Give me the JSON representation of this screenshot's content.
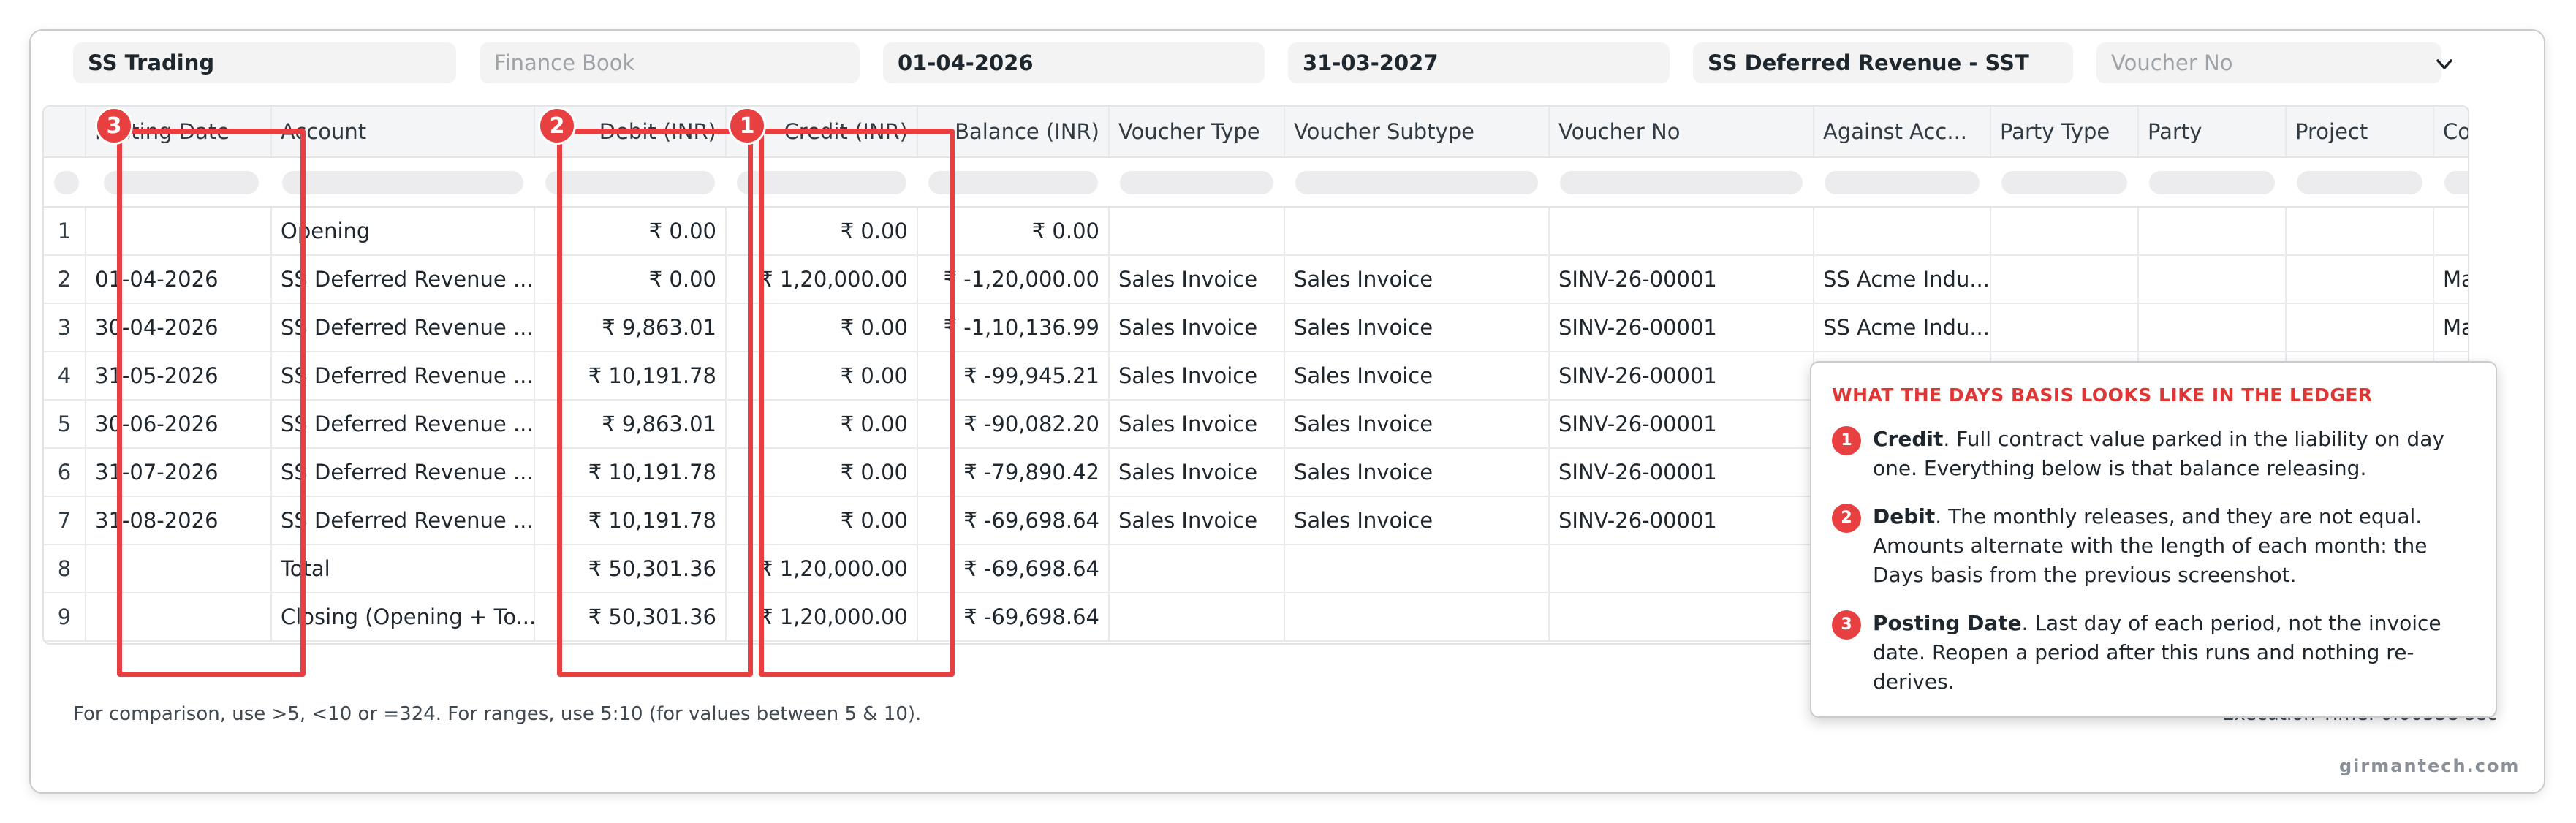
{
  "filters": {
    "company": "SS Trading",
    "finance_book_placeholder": "Finance Book",
    "from_date": "01-04-2026",
    "to_date": "31-03-2027",
    "account": "SS Deferred Revenue - SST",
    "voucher_no_placeholder": "Voucher No"
  },
  "table": {
    "columns": [
      "Posting Date",
      "Account",
      "Debit (INR)",
      "Credit (INR)",
      "Balance (INR)",
      "Voucher Type",
      "Voucher Subtype",
      "Voucher No",
      "Against Acc...",
      "Party Type",
      "Party",
      "Project",
      "Co"
    ],
    "rows": [
      {
        "idx": "1",
        "date": "",
        "account": "Opening",
        "debit": "₹ 0.00",
        "credit": "₹ 0.00",
        "balance": "₹ 0.00",
        "vtype": "",
        "vsub": "",
        "vno": "",
        "against": "",
        "ptype": "",
        "party": "",
        "project": "",
        "co": ""
      },
      {
        "idx": "2",
        "date": "01-04-2026",
        "account": "SS Deferred Revenue ...",
        "debit": "₹ 0.00",
        "credit": "₹ 1,20,000.00",
        "balance": "₹ -1,20,000.00",
        "vtype": "Sales Invoice",
        "vsub": "Sales Invoice",
        "vno": "SINV-26-00001",
        "against": "SS Acme Indu...",
        "ptype": "",
        "party": "",
        "project": "",
        "co": "Ma"
      },
      {
        "idx": "3",
        "date": "30-04-2026",
        "account": "SS Deferred Revenue ...",
        "debit": "₹ 9,863.01",
        "credit": "₹ 0.00",
        "balance": "₹ -1,10,136.99",
        "vtype": "Sales Invoice",
        "vsub": "Sales Invoice",
        "vno": "SINV-26-00001",
        "against": "SS Acme Indu...",
        "ptype": "",
        "party": "",
        "project": "",
        "co": "Ma"
      },
      {
        "idx": "4",
        "date": "31-05-2026",
        "account": "SS Deferred Revenue ...",
        "debit": "₹ 10,191.78",
        "credit": "₹ 0.00",
        "balance": "₹ -99,945.21",
        "vtype": "Sales Invoice",
        "vsub": "Sales Invoice",
        "vno": "SINV-26-00001",
        "against": "",
        "ptype": "",
        "party": "",
        "project": "",
        "co": ""
      },
      {
        "idx": "5",
        "date": "30-06-2026",
        "account": "SS Deferred Revenue ...",
        "debit": "₹ 9,863.01",
        "credit": "₹ 0.00",
        "balance": "₹ -90,082.20",
        "vtype": "Sales Invoice",
        "vsub": "Sales Invoice",
        "vno": "SINV-26-00001",
        "against": "",
        "ptype": "",
        "party": "",
        "project": "",
        "co": ""
      },
      {
        "idx": "6",
        "date": "31-07-2026",
        "account": "SS Deferred Revenue ...",
        "debit": "₹ 10,191.78",
        "credit": "₹ 0.00",
        "balance": "₹ -79,890.42",
        "vtype": "Sales Invoice",
        "vsub": "Sales Invoice",
        "vno": "SINV-26-00001",
        "against": "",
        "ptype": "",
        "party": "",
        "project": "",
        "co": ""
      },
      {
        "idx": "7",
        "date": "31-08-2026",
        "account": "SS Deferred Revenue ...",
        "debit": "₹ 10,191.78",
        "credit": "₹ 0.00",
        "balance": "₹ -69,698.64",
        "vtype": "Sales Invoice",
        "vsub": "Sales Invoice",
        "vno": "SINV-26-00001",
        "against": "",
        "ptype": "",
        "party": "",
        "project": "",
        "co": ""
      },
      {
        "idx": "8",
        "date": "",
        "account": "Total",
        "debit": "₹ 50,301.36",
        "credit": "₹ 1,20,000.00",
        "balance": "₹ -69,698.64",
        "vtype": "",
        "vsub": "",
        "vno": "",
        "against": "",
        "ptype": "",
        "party": "",
        "project": "",
        "co": ""
      },
      {
        "idx": "9",
        "date": "",
        "account": "Closing (Opening + To...",
        "debit": "₹ 50,301.36",
        "credit": "₹ 1,20,000.00",
        "balance": "₹ -69,698.64",
        "vtype": "",
        "vsub": "",
        "vno": "",
        "against": "",
        "ptype": "",
        "party": "",
        "project": "",
        "co": ""
      }
    ]
  },
  "badges": {
    "credit": "1",
    "debit": "2",
    "posting_date": "3"
  },
  "footnote": "For comparison, use >5, <10 or =324. For ranges, use 5:10 (for values between 5 & 10).",
  "execution_time": "Execution Time: 0.00538 sec",
  "callout": {
    "title": "WHAT THE DAYS BASIS LOOKS LIKE IN THE LEDGER",
    "notes": [
      {
        "num": "1",
        "label": "Credit",
        "text": ". Full contract value parked in the liability on day one. Everything below is that balance releasing."
      },
      {
        "num": "2",
        "label": "Debit",
        "text": ". The monthly releases, and they are not equal. Amounts alternate with the length of each month: the Days basis from the previous screenshot."
      },
      {
        "num": "3",
        "label": "Posting Date",
        "text": ". Last day of each period, not the invoice date. Reopen a period after this runs and nothing re-derives."
      }
    ]
  },
  "watermark": "girmantech.com",
  "colors": {
    "highlight": "#e84040",
    "callout_title": "#e03535"
  },
  "icons": {
    "filter_dropdown": "chevron-down-icon"
  }
}
